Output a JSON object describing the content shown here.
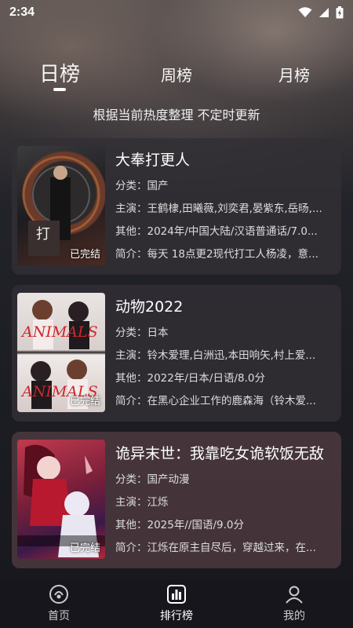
{
  "status_bar": {
    "time": "2:34"
  },
  "tabs": [
    {
      "label": "日榜"
    },
    {
      "label": "周榜"
    },
    {
      "label": "月榜"
    }
  ],
  "subtitle": "根据当前热度整理 不定时更新",
  "cards": [
    {
      "title": "大奉打更人",
      "category": "分类：国产",
      "cast": "主演：王鹤棣,田曦薇,刘奕君,晏紫东,岳旸,...",
      "other": "其他：2024年/中国大陆/汉语普通话/7.0...",
      "intro": "简介：每天 18点更2现代打工人杨凌，意...",
      "badge": "已完结"
    },
    {
      "title": "动物2022",
      "category": "分类：日本",
      "cast": "主演：铃木爱理,白洲迅,本田响矢,村上爱...",
      "other": "其他：2022年/日本/日语/8.0分",
      "intro": "简介：在黑心企业工作的鹿森海（铃木爱...",
      "badge": "已完结"
    },
    {
      "title": "诡异末世：我靠吃女诡软饭无敌",
      "category": "分类：国产动漫",
      "cast": "主演：江烁",
      "other": "其他：2025年//国语/9.0分",
      "intro": "简介：江烁在原主自尽后，穿越过来，在...",
      "badge": "已完结"
    }
  ],
  "bottom_nav": [
    {
      "label": "首页",
      "icon": "home-icon"
    },
    {
      "label": "排行榜",
      "icon": "ranking-icon"
    },
    {
      "label": "我的",
      "icon": "profile-icon"
    }
  ]
}
